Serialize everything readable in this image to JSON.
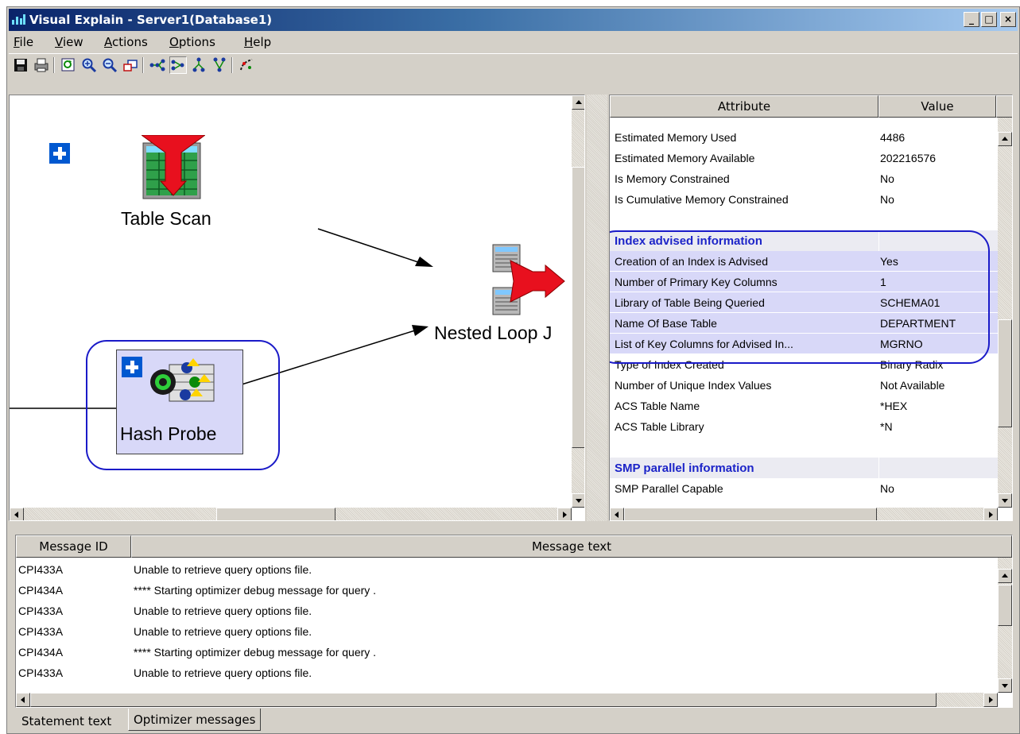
{
  "window": {
    "title": "Visual Explain - Server1(Database1)",
    "buttons": {
      "minimize": "_",
      "maximize": "□",
      "close": "×"
    }
  },
  "menu": [
    "File",
    "View",
    "Actions",
    "Options",
    "Help"
  ],
  "toolbar": {
    "icons": [
      "save-icon",
      "print-icon",
      "refresh-icon",
      "zoom-in-icon",
      "zoom-out-icon",
      "fit-icon",
      "layout-horizontal-icon",
      "layout-horizontal-compact-icon",
      "layout-vertical-icon",
      "layout-vertical-compact-icon",
      "highlight-icon"
    ]
  },
  "graph": {
    "nodes": {
      "table_scan": "Table Scan",
      "nested_loop": "Nested Loop J",
      "hash_probe": "Hash Probe"
    },
    "colors": {
      "callout": "#1a1ac8",
      "node_selected": "#d8d8f8",
      "arrow": "#e8101e"
    }
  },
  "attributes": {
    "headers": {
      "attribute": "Attribute",
      "value": "Value"
    },
    "rows": [
      {
        "a": "Estimated Memory Used",
        "v": "4486"
      },
      {
        "a": "Estimated Memory Available",
        "v": "202216576"
      },
      {
        "a": "Is Memory Constrained",
        "v": "No"
      },
      {
        "a": "Is Cumulative Memory Constrained",
        "v": "No"
      },
      {
        "a": "",
        "v": ""
      },
      {
        "a": "Index advised information",
        "v": "",
        "section": true
      },
      {
        "a": "Creation of an Index is Advised",
        "v": "Yes",
        "highlight": true
      },
      {
        "a": "Number of Primary Key Columns",
        "v": "1",
        "highlight": true
      },
      {
        "a": "Library of Table Being Queried",
        "v": "SCHEMA01",
        "highlight": true
      },
      {
        "a": "Name Of Base Table",
        "v": "DEPARTMENT",
        "highlight": true
      },
      {
        "a": "List of Key Columns for Advised In...",
        "v": "MGRNO",
        "highlight": true
      },
      {
        "a": "Type of Index Created",
        "v": "Binary Radix"
      },
      {
        "a": "Number of Unique Index Values",
        "v": "Not Available"
      },
      {
        "a": "ACS Table Name",
        "v": "*HEX"
      },
      {
        "a": "ACS Table Library",
        "v": "*N"
      },
      {
        "a": "",
        "v": ""
      },
      {
        "a": "SMP parallel information",
        "v": "",
        "section": true
      },
      {
        "a": "SMP Parallel Capable",
        "v": "No"
      }
    ]
  },
  "messages": {
    "headers": {
      "id": "Message ID",
      "text": "Message text"
    },
    "rows": [
      {
        "id": "CPI433A",
        "text": "Unable to retrieve query options file."
      },
      {
        "id": "CPI434A",
        "text": "**** Starting optimizer debug message for query ."
      },
      {
        "id": "CPI433A",
        "text": "Unable to retrieve query options file."
      },
      {
        "id": "CPI433A",
        "text": "Unable to retrieve query options file."
      },
      {
        "id": "CPI434A",
        "text": "**** Starting optimizer debug message for query ."
      },
      {
        "id": "CPI433A",
        "text": "Unable to retrieve query options file."
      }
    ]
  },
  "tabs": [
    "Statement text",
    "Optimizer messages"
  ]
}
